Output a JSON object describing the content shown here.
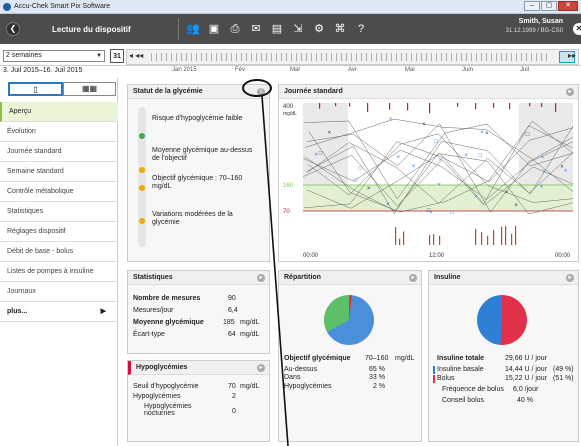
{
  "titlebar": {
    "title": "Accu-Chek Smart Pix Software"
  },
  "toolbar": {
    "section": "Lecture du dispositif",
    "icons": [
      "people-icon",
      "save-icon",
      "print-icon",
      "mail-icon",
      "pdf-icon",
      "export-icon",
      "settings-icon",
      "device-icon",
      "help-icon"
    ],
    "user_name": "Smith, Susan",
    "user_info": "31.12.1999 / BG-CSII"
  },
  "period": {
    "selector": "2 semaines",
    "calendar": "31",
    "range": "3. Juil 2015–16. Juil 2015",
    "months": [
      "Jan 2015",
      "Fév",
      "Mar",
      "Avr",
      "Mai",
      "Juin",
      "Juil"
    ]
  },
  "sidebar": {
    "items": [
      "Aperçu",
      "Évolution",
      "Journée standard",
      "Semaine standard",
      "Contrôle métabolique",
      "Statistiques",
      "Réglages dispositif",
      "Débit de base - bolus",
      "Listes de pompes à insuline",
      "Journaux",
      "plus..."
    ]
  },
  "status_panel": {
    "title": "Statut de la glycémie",
    "rows": [
      {
        "text": "Risque d'hypoglycémie faible",
        "color": "#3fae4a"
      },
      {
        "text": "Moyenne glycémique au-dessus de l'objectif",
        "color": "#f2a900"
      },
      {
        "text": "Objectif glycémique : 70–160 mg/dL",
        "color": "#f2a900"
      },
      {
        "text": "Variations modérées de la glycémie",
        "color": "#f2a900"
      }
    ]
  },
  "standard_day": {
    "title": "Journée standard",
    "y_unit": "mg/dL",
    "y_labels": [
      "400",
      "160",
      "70"
    ],
    "x_labels": [
      "00:00",
      "12:00",
      "00:00"
    ]
  },
  "stats_panel": {
    "title": "Statistiques",
    "rows": [
      {
        "label": "Nombre de mesures",
        "value": "90",
        "unit": ""
      },
      {
        "label": "Mesures/jour",
        "value": "6,4",
        "unit": ""
      },
      {
        "label": "Moyenne glycémique",
        "value": "185",
        "unit": "mg/dL"
      },
      {
        "label": "Écart-type",
        "value": "64",
        "unit": "mg/dL"
      }
    ]
  },
  "hypo_panel": {
    "title": "Hypoglycémies",
    "rows": [
      {
        "label": "Seuil d'hypoglycémie",
        "value": "70",
        "unit": "mg/dL"
      },
      {
        "label": "Hypoglycémies",
        "value": "2",
        "unit": ""
      },
      {
        "label": "Hypoglycémies nocturnes",
        "value": "0",
        "unit": ""
      }
    ]
  },
  "repartition": {
    "title": "Répartition",
    "target_label": "Objectif glycémique",
    "target_value": "70–160",
    "target_unit": "mg/dL",
    "rows": [
      {
        "label": "Au-dessus",
        "value": "65 %"
      },
      {
        "label": "Dans",
        "value": "33 %"
      },
      {
        "label": "Hypoglycémies",
        "value": "2 %"
      }
    ],
    "colors": {
      "above": "#4a90d9",
      "within": "#5cbf6a",
      "below": "#e0304a"
    }
  },
  "insuline": {
    "title": "Insuline",
    "rows": [
      {
        "label": "Insuline totale",
        "value": "29,66 U / jour",
        "pct": ""
      },
      {
        "label": "Insuline basale",
        "value": "14,44 U / jour",
        "pct": "(49 %)"
      },
      {
        "label": "Bolus",
        "value": "15,22 U / jour",
        "pct": "(51 %)"
      },
      {
        "label": "Fréquence de bolus",
        "value": "6,0 /jour",
        "pct": ""
      },
      {
        "label": "Conseil bolus",
        "value": "40 %",
        "pct": ""
      }
    ],
    "colors": {
      "basal": "#2f7fd6",
      "bolus": "#e0304a"
    }
  }
}
